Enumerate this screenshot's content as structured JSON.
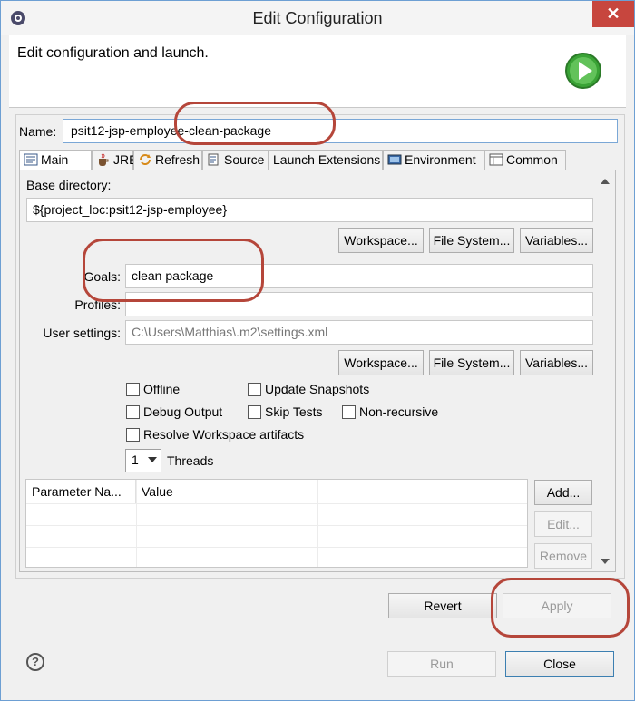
{
  "window": {
    "title": "Edit Configuration",
    "close_glyph": "✕"
  },
  "banner": {
    "message": "Edit configuration and launch.",
    "icon": "run-icon"
  },
  "name": {
    "label": "Name:",
    "value": "psit12-jsp-employee-clean-package"
  },
  "tabs": [
    {
      "label": "Main",
      "icon": "main-tab-icon",
      "active": true
    },
    {
      "label": "JRE",
      "icon": "jre-icon"
    },
    {
      "label": "Refresh",
      "icon": "refresh-icon"
    },
    {
      "label": "Source",
      "icon": "source-icon"
    },
    {
      "label": "Launch Extensions"
    },
    {
      "label": "Environment",
      "icon": "environment-icon"
    },
    {
      "label": "Common",
      "icon": "common-icon"
    }
  ],
  "main": {
    "base_dir_label": "Base directory:",
    "base_dir_value": "${project_loc:psit12-jsp-employee}",
    "workspace_btn": "Workspace...",
    "filesystem_btn": "File System...",
    "variables_btn": "Variables...",
    "goals_label": "Goals:",
    "goals_value": "clean package",
    "profiles_label": "Profiles:",
    "profiles_value": "",
    "user_settings_label": "User settings:",
    "user_settings_value": "C:\\Users\\Matthias\\.m2\\settings.xml",
    "checkboxes": {
      "offline": "Offline",
      "update_snapshots": "Update Snapshots",
      "debug_output": "Debug Output",
      "skip_tests": "Skip Tests",
      "non_recursive": "Non-recursive",
      "resolve_workspace": "Resolve Workspace artifacts"
    },
    "threads_value": "1",
    "threads_label": "Threads",
    "table": {
      "columns": [
        "Parameter Na...",
        "Value"
      ]
    },
    "add_btn": "Add...",
    "edit_btn": "Edit...",
    "remove_btn": "Remove"
  },
  "footer": {
    "revert_btn": "Revert",
    "apply_btn": "Apply",
    "run_btn": "Run",
    "close_btn": "Close",
    "help_glyph": "?"
  },
  "colors": {
    "highlight_ring": "#b5463a",
    "close_button": "#c7463e",
    "run_icon": "#3aa336"
  }
}
